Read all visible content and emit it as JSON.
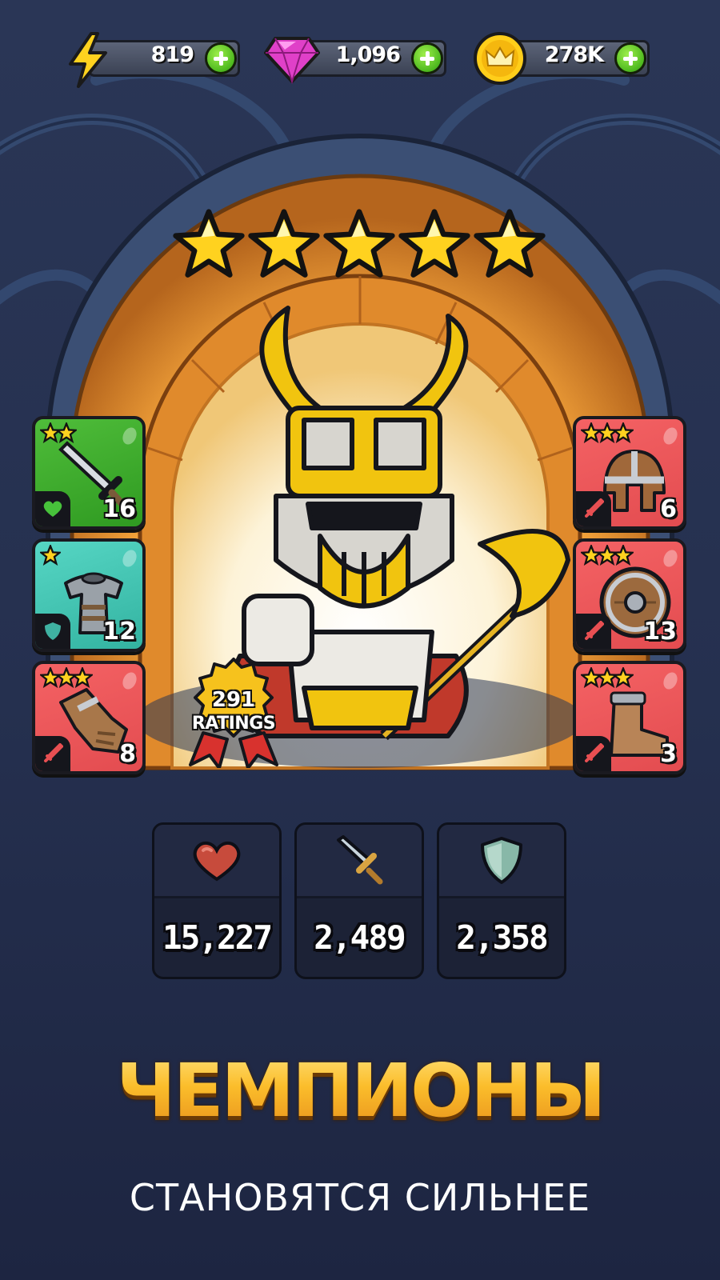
{
  "currencies": [
    {
      "name": "energy",
      "icon": "lightning-icon",
      "value": "819"
    },
    {
      "name": "gems",
      "icon": "gem-icon",
      "value": "1,096"
    },
    {
      "name": "gold",
      "icon": "crown-coin-icon",
      "value": "278K"
    }
  ],
  "hero": {
    "stars": 5,
    "ratings_count": "291",
    "ratings_label": "RATINGS"
  },
  "equipment_left": [
    {
      "item": "sword-icon",
      "color": "#3aa82a",
      "stars": 2,
      "slot_icon": "heart-icon",
      "level": "16"
    },
    {
      "item": "armor-icon",
      "color": "#44c6b3",
      "stars": 1,
      "slot_icon": "shield-icon",
      "level": "12"
    },
    {
      "item": "gauntlet-icon",
      "color": "#ec5659",
      "stars": 3,
      "slot_icon": "sword-icon",
      "level": "8"
    }
  ],
  "equipment_right": [
    {
      "item": "helmet-icon",
      "color": "#ec5659",
      "stars": 3,
      "slot_icon": "sword-icon",
      "level": "6"
    },
    {
      "item": "round-shield-icon",
      "color": "#ec5659",
      "stars": 3,
      "slot_icon": "sword-icon",
      "level": "13"
    },
    {
      "item": "boot-icon",
      "color": "#ec5659",
      "stars": 3,
      "slot_icon": "sword-icon",
      "level": "3"
    }
  ],
  "stats": [
    {
      "icon": "heart-icon",
      "value": "15,227"
    },
    {
      "icon": "sword-icon",
      "value": "2,489"
    },
    {
      "icon": "shield-icon",
      "value": "2,358"
    }
  ],
  "headline": "ЧЕМПИОНЫ",
  "subline": "СТАНОВЯТСЯ СИЛЬНЕЕ"
}
